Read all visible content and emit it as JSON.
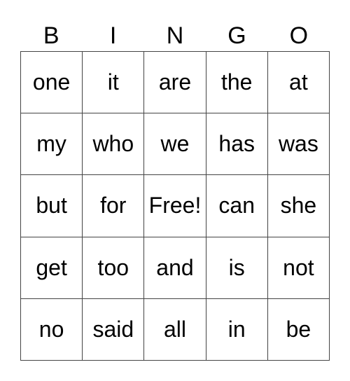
{
  "header": [
    "B",
    "I",
    "N",
    "G",
    "O"
  ],
  "rows": [
    [
      "one",
      "it",
      "are",
      "the",
      "at"
    ],
    [
      "my",
      "who",
      "we",
      "has",
      "was"
    ],
    [
      "but",
      "for",
      "Free!",
      "can",
      "she"
    ],
    [
      "get",
      "too",
      "and",
      "is",
      "not"
    ],
    [
      "no",
      "said",
      "all",
      "in",
      "be"
    ]
  ]
}
